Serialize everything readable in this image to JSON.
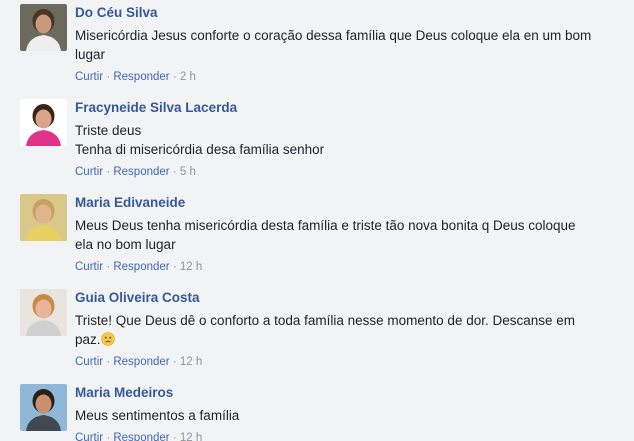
{
  "comments": [
    {
      "author": "Do Céu Silva",
      "lines": [
        "Misericórdia Jesus conforte o coração dessa família que Deus coloque ela en um bom",
        "lugar"
      ],
      "like_label": "Curtir",
      "reply_label": "Responder",
      "time": "2 h",
      "avatar_colors": {
        "bg": "#6b6a5e",
        "skin": "#c89a7a",
        "hair": "#4a3424",
        "clothes": "#eeeeee"
      }
    },
    {
      "author": "Fracyneide Silva Lacerda",
      "lines": [
        "Triste deus",
        "Tenha di misericórdia desa família senhor"
      ],
      "like_label": "Curtir",
      "reply_label": "Responder",
      "time": "5 h",
      "avatar_colors": {
        "bg": "#ffffff",
        "skin": "#d9a48a",
        "hair": "#3a2418",
        "clothes": "#e0338a"
      }
    },
    {
      "author": "Maria Edivaneide",
      "lines": [
        "Meus Deus tenha misericórdia desta família e triste tão nova bonita q Deus coloque",
        "ela no bom lugar"
      ],
      "like_label": "Curtir",
      "reply_label": "Responder",
      "time": "12 h",
      "avatar_colors": {
        "bg": "#d8c98a",
        "skin": "#e0b48e",
        "hair": "#c8a060",
        "clothes": "#e8d060"
      }
    },
    {
      "author": "Guia Oliveira Costa",
      "lines": [
        "Triste! Que Deus dê o conforto a toda família nesse momento de dor. Descanse em",
        "paz."
      ],
      "emoji": "sad-face",
      "like_label": "Curtir",
      "reply_label": "Responder",
      "time": "12 h",
      "avatar_colors": {
        "bg": "#e8e4df",
        "skin": "#e8b49a",
        "hair": "#c88a4a",
        "clothes": "#d0d0d0"
      }
    },
    {
      "author": "Maria Medeiros",
      "lines": [
        "Meus sentimentos a família"
      ],
      "like_label": "Curtir",
      "reply_label": "Responder",
      "time": "12 h",
      "avatar_colors": {
        "bg": "#8fb8d8",
        "skin": "#c89070",
        "hair": "#2a1e18",
        "clothes": "#404850"
      }
    }
  ],
  "colors": {
    "background": "#f2f3f5",
    "author": "#365899",
    "text": "#1d2129",
    "action_link": "#4267b2",
    "meta": "#90949c"
  }
}
